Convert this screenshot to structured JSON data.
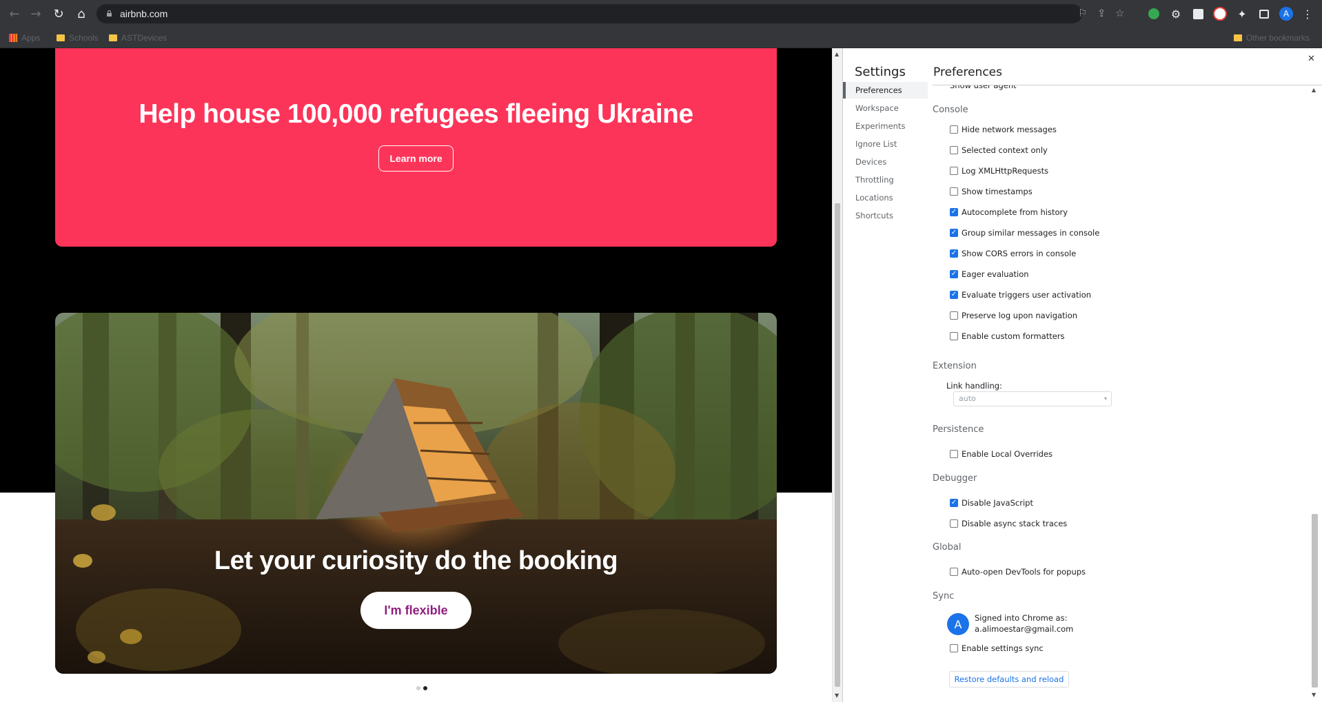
{
  "browser": {
    "url": "airbnb.com",
    "bookmarks": [
      "Apps",
      "Schools",
      "ASTDevices"
    ],
    "other_bookmarks": "Other bookmarks",
    "profile_initial": "A"
  },
  "page": {
    "hero_title": "Help house 100,000 refugees fleeing Ukraine",
    "learn_more": "Learn more",
    "forest_title": "Let your curiosity do the booking",
    "flexible_button": "I'm flexible",
    "carousel_active_index": 1,
    "colors": {
      "hero": "#fd3459",
      "flexible_text": "#8f1e7c"
    }
  },
  "devtools": {
    "settings_title": "Settings",
    "panel_title": "Preferences",
    "nav": [
      "Preferences",
      "Workspace",
      "Experiments",
      "Ignore List",
      "Devices",
      "Throttling",
      "Locations",
      "Shortcuts"
    ],
    "partial_row": "Show user agent shadow DOM",
    "sections": {
      "console": "Console",
      "extension": "Extension",
      "persistence": "Persistence",
      "debugger": "Debugger",
      "global": "Global",
      "sync": "Sync"
    },
    "console_options": [
      {
        "label": "Hide network messages",
        "checked": false
      },
      {
        "label": "Selected context only",
        "checked": false
      },
      {
        "label": "Log XMLHttpRequests",
        "checked": false
      },
      {
        "label": "Show timestamps",
        "checked": false
      },
      {
        "label": "Autocomplete from history",
        "checked": true
      },
      {
        "label": "Group similar messages in console",
        "checked": true
      },
      {
        "label": "Show CORS errors in console",
        "checked": true
      },
      {
        "label": "Eager evaluation",
        "checked": true
      },
      {
        "label": "Evaluate triggers user activation",
        "checked": true
      },
      {
        "label": "Preserve log upon navigation",
        "checked": false
      },
      {
        "label": "Enable custom formatters",
        "checked": false
      }
    ],
    "link_handling_label": "Link handling:",
    "link_handling_value": "auto",
    "persistence_options": [
      {
        "label": "Enable Local Overrides",
        "checked": false
      }
    ],
    "debugger_options": [
      {
        "label": "Disable JavaScript",
        "checked": true
      },
      {
        "label": "Disable async stack traces",
        "checked": false
      }
    ],
    "global_options": [
      {
        "label": "Auto-open DevTools for popups",
        "checked": false
      }
    ],
    "sync": {
      "avatar_initial": "A",
      "signed_in_label": "Signed into Chrome as:",
      "email": "a.alimoestar@gmail.com",
      "enable_sync": {
        "label": "Enable settings sync",
        "checked": false
      }
    },
    "restore_button": "Restore defaults and reload"
  }
}
